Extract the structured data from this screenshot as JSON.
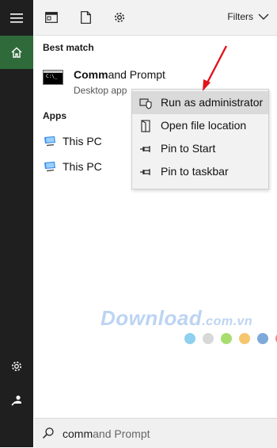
{
  "toolbar": {
    "filters_label": "Filters"
  },
  "best_match": {
    "heading": "Best match",
    "title_bold": "Comm",
    "title_rest": "and Prompt",
    "subtitle": "Desktop app"
  },
  "apps": {
    "heading": "Apps",
    "items": [
      {
        "label": "This PC"
      },
      {
        "label": "This PC"
      }
    ]
  },
  "context_menu": {
    "items": [
      {
        "label": "Run as administrator",
        "icon": "shield-icon",
        "highlighted": true
      },
      {
        "label": "Open file location",
        "icon": "folder-location-icon",
        "highlighted": false
      },
      {
        "label": "Pin to Start",
        "icon": "pin-icon",
        "highlighted": false
      },
      {
        "label": "Pin to taskbar",
        "icon": "pin-icon",
        "highlighted": false
      }
    ]
  },
  "watermark": {
    "brand": "Download",
    "tld": ".com.vn"
  },
  "watermark_dots": [
    "#8dd0f0",
    "#d8d8d8",
    "#a7dd6e",
    "#f6c66e",
    "#7fa9d9",
    "#ef8a8a"
  ],
  "search": {
    "typed": "comm",
    "suggestion": "and Prompt"
  },
  "colors": {
    "sidebar_bg": "#1f1f1f",
    "home_bg": "#2f6b3a",
    "arrow": "#e0141d"
  }
}
